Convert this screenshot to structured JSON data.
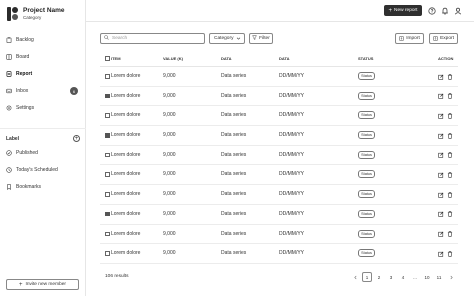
{
  "app": {
    "title": "Project Name",
    "subtitle": "Category"
  },
  "sidebar": {
    "items": [
      {
        "label": "Backlog",
        "icon": "clipboard-icon"
      },
      {
        "label": "Board",
        "icon": "board-icon"
      },
      {
        "label": "Report",
        "icon": "report-icon",
        "active": true
      },
      {
        "label": "Inbox",
        "icon": "inbox-icon",
        "badge": "6"
      },
      {
        "label": "Settings",
        "icon": "gear-icon"
      }
    ],
    "label_heading": "Label",
    "label_items": [
      {
        "label": "Published",
        "icon": "check-circle-icon"
      },
      {
        "label": "Today's Scheduled",
        "icon": "clock-icon"
      },
      {
        "label": "Bookmarks",
        "icon": "bookmark-icon"
      }
    ],
    "invite_label": "Invite new member"
  },
  "topbar": {
    "new_report_label": "New report"
  },
  "toolbar": {
    "search_placeholder": "Search",
    "category_label": "Category",
    "filter_label": "Filter",
    "import_label": "Import",
    "export_label": "Export"
  },
  "table": {
    "headers": {
      "item": "ITEM",
      "value": "VALUE (K)",
      "data1": "DATA",
      "data2": "DATA",
      "status": "STATUS",
      "action": "ACTION"
    },
    "rows": [
      {
        "item": "Lorem dolore",
        "value": "9,000",
        "series": "Data series",
        "date": "DD/MM/YY",
        "status": "Status",
        "checked": false
      },
      {
        "item": "Lorem dolore",
        "value": "9,000",
        "series": "Data series",
        "date": "DD/MM/YY",
        "status": "Status",
        "checked": true
      },
      {
        "item": "Lorem dolore",
        "value": "9,000",
        "series": "Data series",
        "date": "DD/MM/YY",
        "status": "Status",
        "checked": false
      },
      {
        "item": "Lorem dolore",
        "value": "9,000",
        "series": "Data series",
        "date": "DD/MM/YY",
        "status": "Status",
        "checked": true
      },
      {
        "item": "Lorem dolore",
        "value": "9,000",
        "series": "Data series",
        "date": "DD/MM/YY",
        "status": "Status",
        "checked": false
      },
      {
        "item": "Lorem dolore",
        "value": "9,000",
        "series": "Data series",
        "date": "DD/MM/YY",
        "status": "Status",
        "checked": false
      },
      {
        "item": "Lorem dolore",
        "value": "9,000",
        "series": "Data series",
        "date": "DD/MM/YY",
        "status": "Status",
        "checked": false
      },
      {
        "item": "Lorem dolore",
        "value": "9,000",
        "series": "Data series",
        "date": "DD/MM/YY",
        "status": "Status",
        "checked": true
      },
      {
        "item": "Lorem dolore",
        "value": "9,000",
        "series": "Data series",
        "date": "DD/MM/YY",
        "status": "Status",
        "checked": false
      },
      {
        "item": "Lorem dolore",
        "value": "9,000",
        "series": "Data series",
        "date": "DD/MM/YY",
        "status": "Status",
        "checked": false
      }
    ]
  },
  "footer": {
    "results": "106 results",
    "pages": [
      "1",
      "2",
      "3",
      "4",
      "...",
      "10",
      "11"
    ],
    "current_page": "1"
  }
}
